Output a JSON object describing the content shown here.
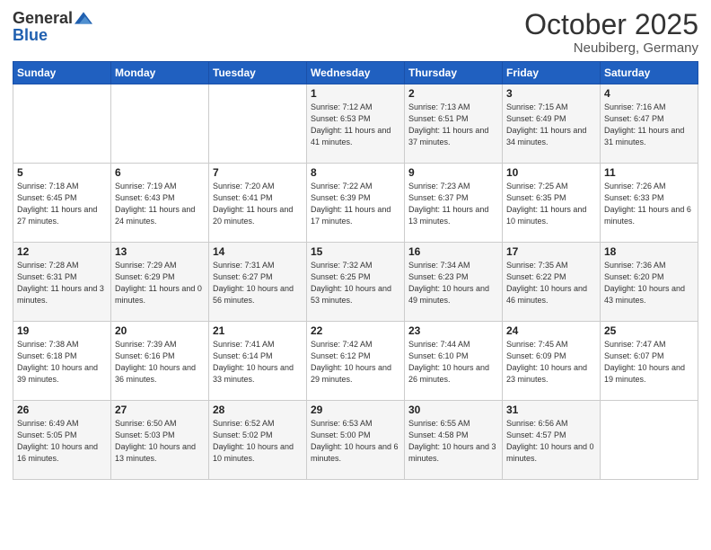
{
  "logo": {
    "general": "General",
    "blue": "Blue"
  },
  "title": {
    "month": "October 2025",
    "location": "Neubiberg, Germany"
  },
  "days_header": [
    "Sunday",
    "Monday",
    "Tuesday",
    "Wednesday",
    "Thursday",
    "Friday",
    "Saturday"
  ],
  "weeks": [
    [
      {
        "day": "",
        "sunrise": "",
        "sunset": "",
        "daylight": ""
      },
      {
        "day": "",
        "sunrise": "",
        "sunset": "",
        "daylight": ""
      },
      {
        "day": "",
        "sunrise": "",
        "sunset": "",
        "daylight": ""
      },
      {
        "day": "1",
        "sunrise": "Sunrise: 7:12 AM",
        "sunset": "Sunset: 6:53 PM",
        "daylight": "Daylight: 11 hours and 41 minutes."
      },
      {
        "day": "2",
        "sunrise": "Sunrise: 7:13 AM",
        "sunset": "Sunset: 6:51 PM",
        "daylight": "Daylight: 11 hours and 37 minutes."
      },
      {
        "day": "3",
        "sunrise": "Sunrise: 7:15 AM",
        "sunset": "Sunset: 6:49 PM",
        "daylight": "Daylight: 11 hours and 34 minutes."
      },
      {
        "day": "4",
        "sunrise": "Sunrise: 7:16 AM",
        "sunset": "Sunset: 6:47 PM",
        "daylight": "Daylight: 11 hours and 31 minutes."
      }
    ],
    [
      {
        "day": "5",
        "sunrise": "Sunrise: 7:18 AM",
        "sunset": "Sunset: 6:45 PM",
        "daylight": "Daylight: 11 hours and 27 minutes."
      },
      {
        "day": "6",
        "sunrise": "Sunrise: 7:19 AM",
        "sunset": "Sunset: 6:43 PM",
        "daylight": "Daylight: 11 hours and 24 minutes."
      },
      {
        "day": "7",
        "sunrise": "Sunrise: 7:20 AM",
        "sunset": "Sunset: 6:41 PM",
        "daylight": "Daylight: 11 hours and 20 minutes."
      },
      {
        "day": "8",
        "sunrise": "Sunrise: 7:22 AM",
        "sunset": "Sunset: 6:39 PM",
        "daylight": "Daylight: 11 hours and 17 minutes."
      },
      {
        "day": "9",
        "sunrise": "Sunrise: 7:23 AM",
        "sunset": "Sunset: 6:37 PM",
        "daylight": "Daylight: 11 hours and 13 minutes."
      },
      {
        "day": "10",
        "sunrise": "Sunrise: 7:25 AM",
        "sunset": "Sunset: 6:35 PM",
        "daylight": "Daylight: 11 hours and 10 minutes."
      },
      {
        "day": "11",
        "sunrise": "Sunrise: 7:26 AM",
        "sunset": "Sunset: 6:33 PM",
        "daylight": "Daylight: 11 hours and 6 minutes."
      }
    ],
    [
      {
        "day": "12",
        "sunrise": "Sunrise: 7:28 AM",
        "sunset": "Sunset: 6:31 PM",
        "daylight": "Daylight: 11 hours and 3 minutes."
      },
      {
        "day": "13",
        "sunrise": "Sunrise: 7:29 AM",
        "sunset": "Sunset: 6:29 PM",
        "daylight": "Daylight: 11 hours and 0 minutes."
      },
      {
        "day": "14",
        "sunrise": "Sunrise: 7:31 AM",
        "sunset": "Sunset: 6:27 PM",
        "daylight": "Daylight: 10 hours and 56 minutes."
      },
      {
        "day": "15",
        "sunrise": "Sunrise: 7:32 AM",
        "sunset": "Sunset: 6:25 PM",
        "daylight": "Daylight: 10 hours and 53 minutes."
      },
      {
        "day": "16",
        "sunrise": "Sunrise: 7:34 AM",
        "sunset": "Sunset: 6:23 PM",
        "daylight": "Daylight: 10 hours and 49 minutes."
      },
      {
        "day": "17",
        "sunrise": "Sunrise: 7:35 AM",
        "sunset": "Sunset: 6:22 PM",
        "daylight": "Daylight: 10 hours and 46 minutes."
      },
      {
        "day": "18",
        "sunrise": "Sunrise: 7:36 AM",
        "sunset": "Sunset: 6:20 PM",
        "daylight": "Daylight: 10 hours and 43 minutes."
      }
    ],
    [
      {
        "day": "19",
        "sunrise": "Sunrise: 7:38 AM",
        "sunset": "Sunset: 6:18 PM",
        "daylight": "Daylight: 10 hours and 39 minutes."
      },
      {
        "day": "20",
        "sunrise": "Sunrise: 7:39 AM",
        "sunset": "Sunset: 6:16 PM",
        "daylight": "Daylight: 10 hours and 36 minutes."
      },
      {
        "day": "21",
        "sunrise": "Sunrise: 7:41 AM",
        "sunset": "Sunset: 6:14 PM",
        "daylight": "Daylight: 10 hours and 33 minutes."
      },
      {
        "day": "22",
        "sunrise": "Sunrise: 7:42 AM",
        "sunset": "Sunset: 6:12 PM",
        "daylight": "Daylight: 10 hours and 29 minutes."
      },
      {
        "day": "23",
        "sunrise": "Sunrise: 7:44 AM",
        "sunset": "Sunset: 6:10 PM",
        "daylight": "Daylight: 10 hours and 26 minutes."
      },
      {
        "day": "24",
        "sunrise": "Sunrise: 7:45 AM",
        "sunset": "Sunset: 6:09 PM",
        "daylight": "Daylight: 10 hours and 23 minutes."
      },
      {
        "day": "25",
        "sunrise": "Sunrise: 7:47 AM",
        "sunset": "Sunset: 6:07 PM",
        "daylight": "Daylight: 10 hours and 19 minutes."
      }
    ],
    [
      {
        "day": "26",
        "sunrise": "Sunrise: 6:49 AM",
        "sunset": "Sunset: 5:05 PM",
        "daylight": "Daylight: 10 hours and 16 minutes."
      },
      {
        "day": "27",
        "sunrise": "Sunrise: 6:50 AM",
        "sunset": "Sunset: 5:03 PM",
        "daylight": "Daylight: 10 hours and 13 minutes."
      },
      {
        "day": "28",
        "sunrise": "Sunrise: 6:52 AM",
        "sunset": "Sunset: 5:02 PM",
        "daylight": "Daylight: 10 hours and 10 minutes."
      },
      {
        "day": "29",
        "sunrise": "Sunrise: 6:53 AM",
        "sunset": "Sunset: 5:00 PM",
        "daylight": "Daylight: 10 hours and 6 minutes."
      },
      {
        "day": "30",
        "sunrise": "Sunrise: 6:55 AM",
        "sunset": "Sunset: 4:58 PM",
        "daylight": "Daylight: 10 hours and 3 minutes."
      },
      {
        "day": "31",
        "sunrise": "Sunrise: 6:56 AM",
        "sunset": "Sunset: 4:57 PM",
        "daylight": "Daylight: 10 hours and 0 minutes."
      },
      {
        "day": "",
        "sunrise": "",
        "sunset": "",
        "daylight": ""
      }
    ]
  ]
}
